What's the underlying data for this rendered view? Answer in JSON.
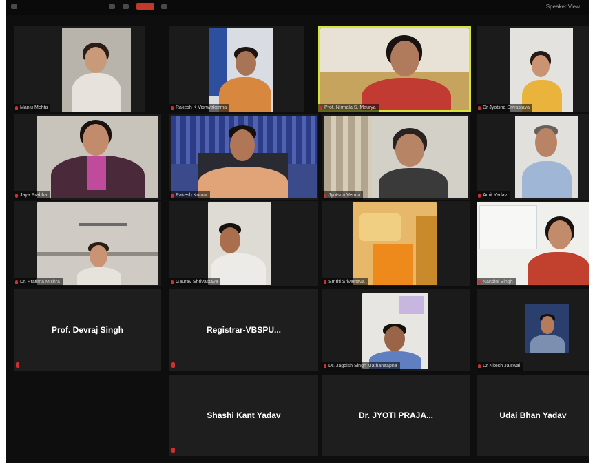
{
  "window": {
    "view_label": "Speaker View"
  },
  "colors": {
    "active_speaker_border": "#d6e43a",
    "muted_mic": "#d0312d",
    "tile_bg": "#1b1b1b"
  },
  "participants": [
    {
      "id": "p1",
      "name": "Manju Mehta",
      "has_video": true
    },
    {
      "id": "p2",
      "name": "Rakesh K Vishwakarma",
      "has_video": true
    },
    {
      "id": "p3",
      "name": "Prof. Nirmala S. Maurya",
      "has_video": true,
      "active_speaker": true
    },
    {
      "id": "p4",
      "name": "Dr Jyotsna Srivastava",
      "has_video": true
    },
    {
      "id": "p5",
      "name": "Jaya Prabha",
      "has_video": true
    },
    {
      "id": "p6",
      "name": "Rakesh Kumar",
      "has_video": true
    },
    {
      "id": "p7",
      "name": "Jyotsna Verma",
      "has_video": true
    },
    {
      "id": "p8",
      "name": "Amit Yadav",
      "has_video": true
    },
    {
      "id": "p9",
      "name": "Dr. Pratima Mishra",
      "has_video": true
    },
    {
      "id": "p10",
      "name": "Gaurav Shrivastava",
      "has_video": true
    },
    {
      "id": "p11",
      "name": "Smriti Srivastava",
      "has_video": true
    },
    {
      "id": "p12",
      "name": "Nandini Singh",
      "has_video": true
    },
    {
      "id": "p13",
      "name": "Prof. Devraj Singh",
      "has_video": false
    },
    {
      "id": "p14",
      "name": "Registrar-VBSPU...",
      "has_video": false
    },
    {
      "id": "p15",
      "name": "Dr. Jagdish Singh Mathanaapna",
      "has_video": true
    },
    {
      "id": "p16",
      "name": "Dr Nitesh Jaiswal",
      "has_video": true
    },
    {
      "id": "p17",
      "name": "Shashi Kant Yadav",
      "has_video": false
    },
    {
      "id": "p18",
      "name": "Dr. JYOTI PRAJA...",
      "has_video": false
    },
    {
      "id": "p19",
      "name": "Udai Bhan Yadav",
      "has_video": false
    }
  ]
}
